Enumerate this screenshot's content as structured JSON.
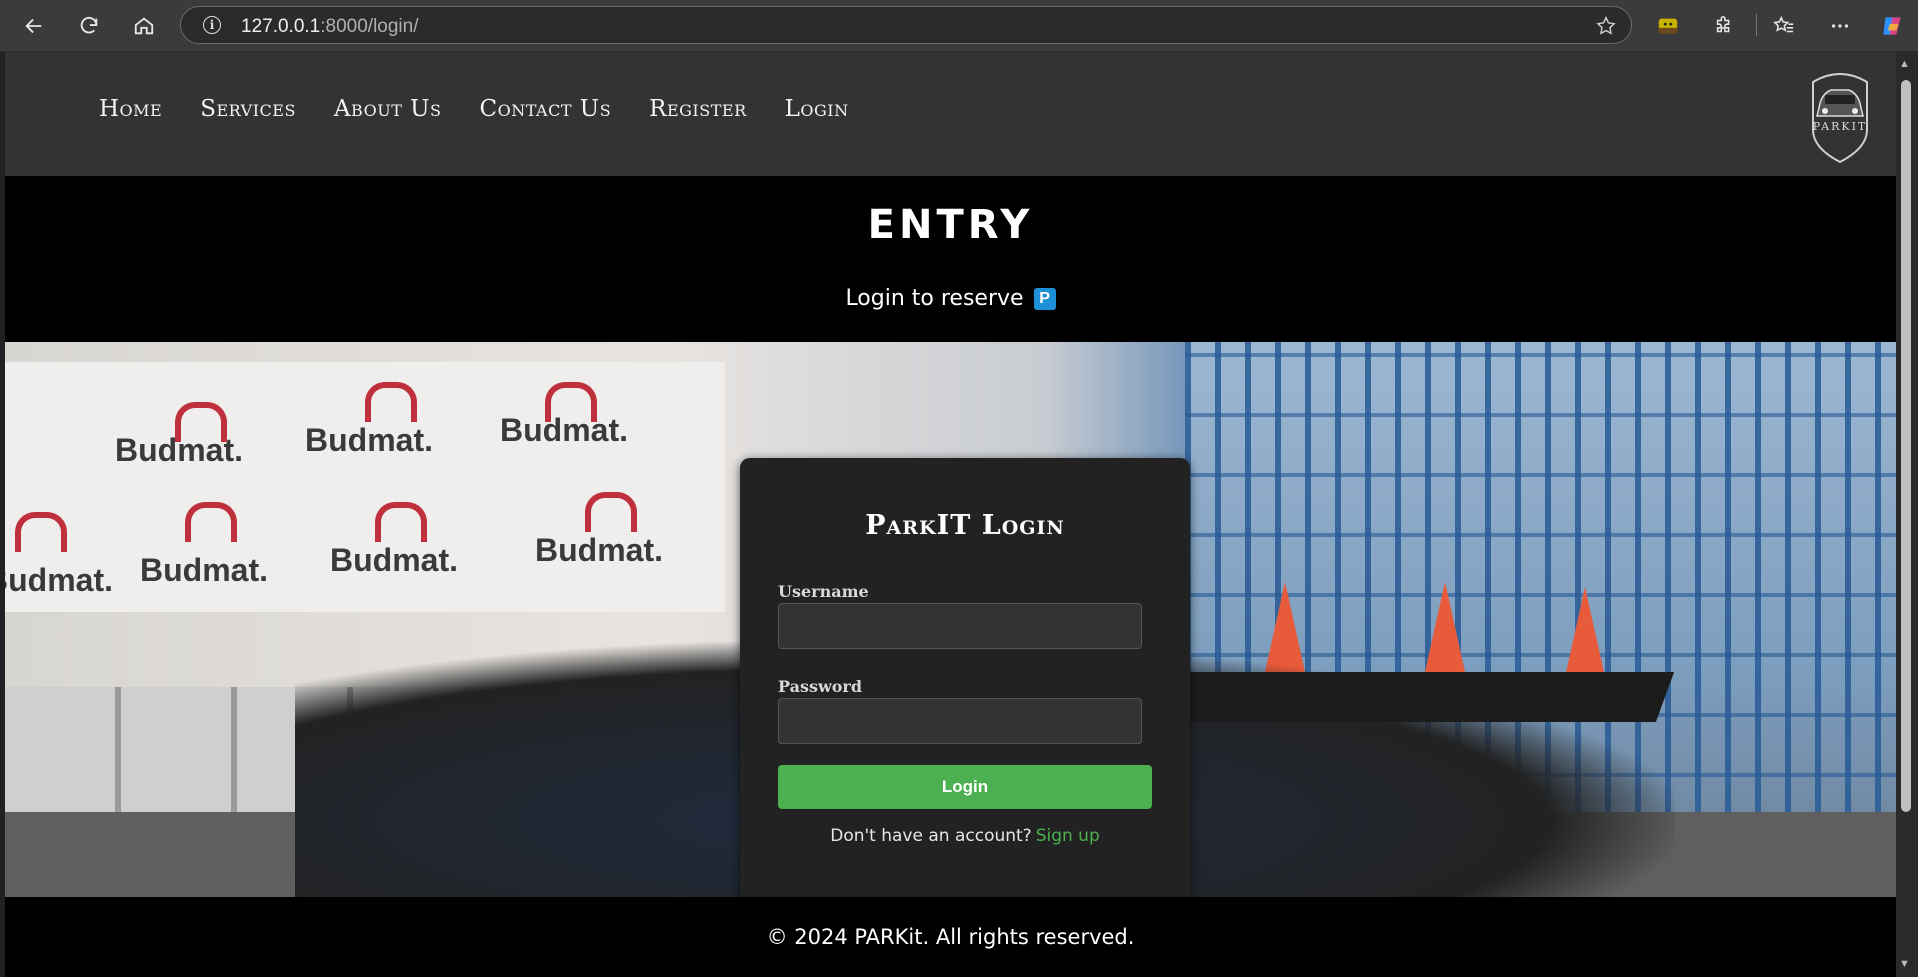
{
  "browser": {
    "url_host": "127.0.0.1",
    "url_path": ":8000/login/"
  },
  "nav": {
    "items": [
      "Home",
      "Services",
      "About Us",
      "Contact Us",
      "Register",
      "Login"
    ]
  },
  "logo": {
    "text": "PARKIT"
  },
  "hero": {
    "title": "ENTRY",
    "subtitle": "Login to reserve",
    "badge": "P"
  },
  "background": {
    "banner_text": "Budmat."
  },
  "login": {
    "title": "ParkIT Login",
    "username_label": "Username",
    "username_value": "",
    "password_label": "Password",
    "password_value": "",
    "button_label": "Login",
    "signup_prompt": "Don't have an account?",
    "signup_link": "Sign up"
  },
  "footer": {
    "text": "© 2024 PARKit. All rights reserved."
  },
  "colors": {
    "accent": "#4caf50",
    "header_bg": "#333333",
    "card_bg": "#222222",
    "badge": "#1e90d8"
  }
}
